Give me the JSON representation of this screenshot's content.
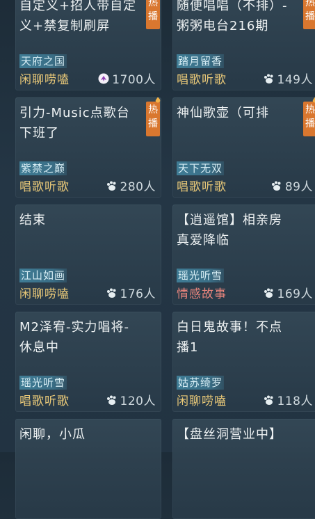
{
  "badge_label": "热播",
  "cards": [
    {
      "title": "自定义+招人带自定义+禁复制刷屏",
      "guild": "天府之国",
      "category": "闲聊唠嗑",
      "category_color": "yellow",
      "count": "1700人",
      "hot": true,
      "special_icon": true
    },
    {
      "title": "随便唱唱（不排）-粥粥电台216期",
      "guild": "踏月留香",
      "category": "唱歌听歌",
      "category_color": "yellow",
      "count": "149人",
      "hot": true,
      "special_icon": false
    },
    {
      "title": "引力-Music点歌台 下班了",
      "guild": "紫禁之巅",
      "category": "唱歌听歌",
      "category_color": "yellow",
      "count": "280人",
      "hot": true,
      "special_icon": false
    },
    {
      "title": "神仙歌壶（可排",
      "guild": "天下无双",
      "category": "唱歌听歌",
      "category_color": "yellow",
      "count": "89人",
      "hot": true,
      "special_icon": false
    },
    {
      "title": "结束",
      "guild": "江山如画",
      "category": "闲聊唠嗑",
      "category_color": "yellow",
      "count": "176人",
      "hot": false,
      "special_icon": false
    },
    {
      "title": "【逍遥馆】相亲房 真爱降临",
      "guild": "瑶光听雪",
      "category": "情感故事",
      "category_color": "red",
      "count": "169人",
      "hot": false,
      "special_icon": false
    },
    {
      "title": "M2泽宥-实力唱将-休息中",
      "guild": "瑶光听雪",
      "category": "唱歌听歌",
      "category_color": "yellow",
      "count": "120人",
      "hot": false,
      "special_icon": false
    },
    {
      "title": "白日鬼故事！不点播1",
      "guild": "姑苏绮罗",
      "category": "闲聊唠嗑",
      "category_color": "yellow",
      "count": "118人",
      "hot": false,
      "special_icon": false
    },
    {
      "title": "闲聊，小瓜",
      "guild": "",
      "category": "",
      "category_color": "yellow",
      "count": "",
      "hot": false,
      "special_icon": false
    },
    {
      "title": "【盘丝洞营业中】",
      "guild": "",
      "category": "",
      "category_color": "yellow",
      "count": "",
      "hot": false,
      "special_icon": false
    }
  ]
}
